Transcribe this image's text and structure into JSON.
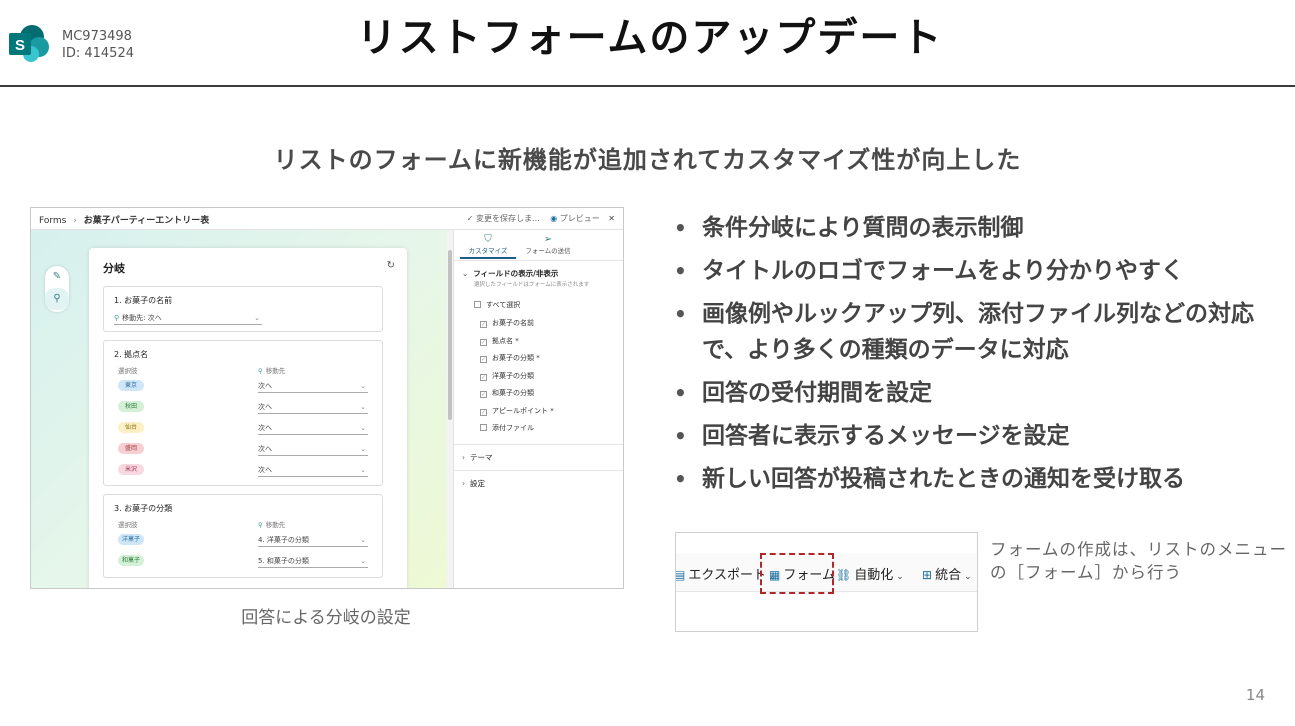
{
  "header": {
    "message_id": "MC973498",
    "id_label": "ID: 414524",
    "title": "リストフォームのアップデート",
    "logo_letter": "S"
  },
  "subtitle": "リストのフォームに新機能が追加されてカスタマイズ性が向上した",
  "left_screenshot": {
    "breadcrumb_root": "Forms",
    "breadcrumb_sep": "›",
    "breadcrumb_current": "お菓子パーティーエントリー表",
    "save_status": "✓ 変更を保存しま...",
    "preview_label": "プレビュー",
    "panel_title": "分岐",
    "q1": {
      "title": "1. お菓子の名前",
      "branch": "移動先: 次へ"
    },
    "q2": {
      "title": "2. 拠点名",
      "options_label": "選択肢",
      "goto_label": "移動先",
      "rows": [
        {
          "option": "東京",
          "color": "#cfe6f7",
          "text_color": "#2d6e9e",
          "goto": "次へ"
        },
        {
          "option": "秋田",
          "color": "#d4f0d6",
          "text_color": "#2f7a3c",
          "goto": "次へ"
        },
        {
          "option": "仙台",
          "color": "#fbefc4",
          "text_color": "#8a6d0a",
          "goto": "次へ"
        },
        {
          "option": "盛岡",
          "color": "#f7cfd2",
          "text_color": "#a23a45",
          "goto": "次へ"
        },
        {
          "option": "米沢",
          "color": "#f9d9e1",
          "text_color": "#a23a5e",
          "goto": "次へ"
        }
      ]
    },
    "q3": {
      "title": "3. お菓子の分類",
      "options_label": "選択肢",
      "goto_label": "移動先",
      "rows": [
        {
          "option": "洋菓子",
          "color": "#cfe6f7",
          "text_color": "#2d6e9e",
          "goto": "4. 洋菓子の分類"
        },
        {
          "option": "和菓子",
          "color": "#d4f0d6",
          "text_color": "#2f7a3c",
          "goto": "5. 和菓子の分類"
        }
      ]
    },
    "side_panel": {
      "tab_customize": "カスタマイズ",
      "tab_send": "フォームの送信",
      "fields_section": "フィールドの表示/非表示",
      "fields_hint": "選択したフィールドはフォームに表示されます",
      "select_all": "すべて選択",
      "fields": [
        "お菓子の名前",
        "拠点名 *",
        "お菓子の分類 *",
        "洋菓子の分類",
        "和菓子の分類",
        "アピールポイント *",
        "添付ファイル"
      ],
      "theme_section": "テーマ",
      "settings_section": "設定"
    },
    "caption": "回答による分岐の設定"
  },
  "bullets": [
    "条件分岐により質問の表示制御",
    "タイトルのロゴでフォームをより分かりやすく",
    "画像例やルックアップ列、添付ファイル列などの対応で、より多くの種類のデータに対応",
    "回答の受付期間を設定",
    "回答者に表示するメッセージを設定",
    "新しい回答が投稿されたときの通知を受け取る"
  ],
  "menu_screenshot": {
    "export": "エクスポート",
    "form": "フォーム",
    "automate": "自動化",
    "integrate": "統合"
  },
  "note": "フォームの作成は、リストのメニューの［フォーム］から行う",
  "page_number": "14"
}
